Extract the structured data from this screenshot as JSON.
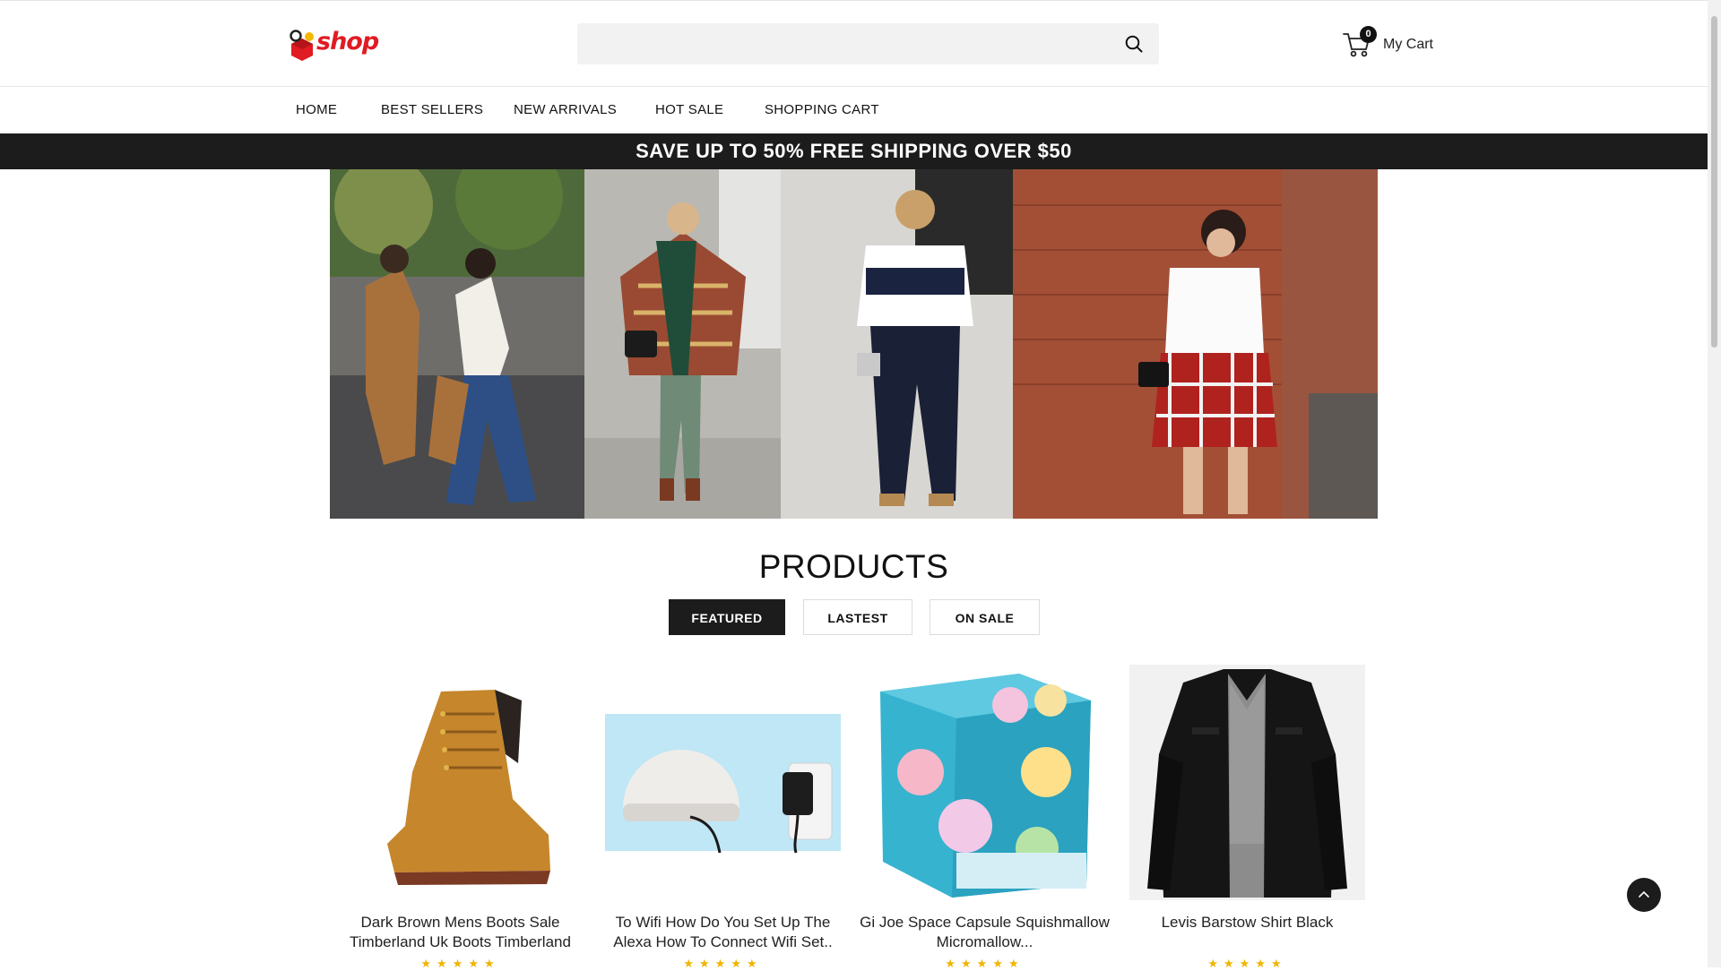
{
  "header": {
    "logo_text": "shop",
    "search": {
      "placeholder": "",
      "value": ""
    },
    "cart": {
      "count": "0",
      "label": "My Cart"
    }
  },
  "nav": {
    "items": [
      {
        "label": "HOME"
      },
      {
        "label": "BEST SELLERS"
      },
      {
        "label": "NEW ARRIVALS"
      },
      {
        "label": "HOT SALE"
      },
      {
        "label": "SHOPPING CART"
      }
    ]
  },
  "promo": {
    "text": "SAVE UP TO 50% FREE SHIPPING OVER $50"
  },
  "products": {
    "title": "PRODUCTS",
    "tabs": [
      {
        "label": "FEATURED",
        "active": true
      },
      {
        "label": "LASTEST",
        "active": false
      },
      {
        "label": "ON SALE",
        "active": false
      }
    ],
    "items": [
      {
        "name": "Dark Brown Mens Boots Sale Timberland Uk Boots Timberland",
        "rating": "★★★★★"
      },
      {
        "name": "To Wifi How Do You Set Up The Alexa How To Connect Wifi Set..",
        "rating": "★★★★★"
      },
      {
        "name": "Gi Joe Space Capsule Squishmallow Micromallow...",
        "rating": "★★★★★"
      },
      {
        "name": "Levis Barstow Shirt Black",
        "rating": "★★★★★"
      }
    ]
  },
  "colors": {
    "brand_red": "#e01b22",
    "dark": "#1c1c1c",
    "rating_star": "#f0b400"
  }
}
